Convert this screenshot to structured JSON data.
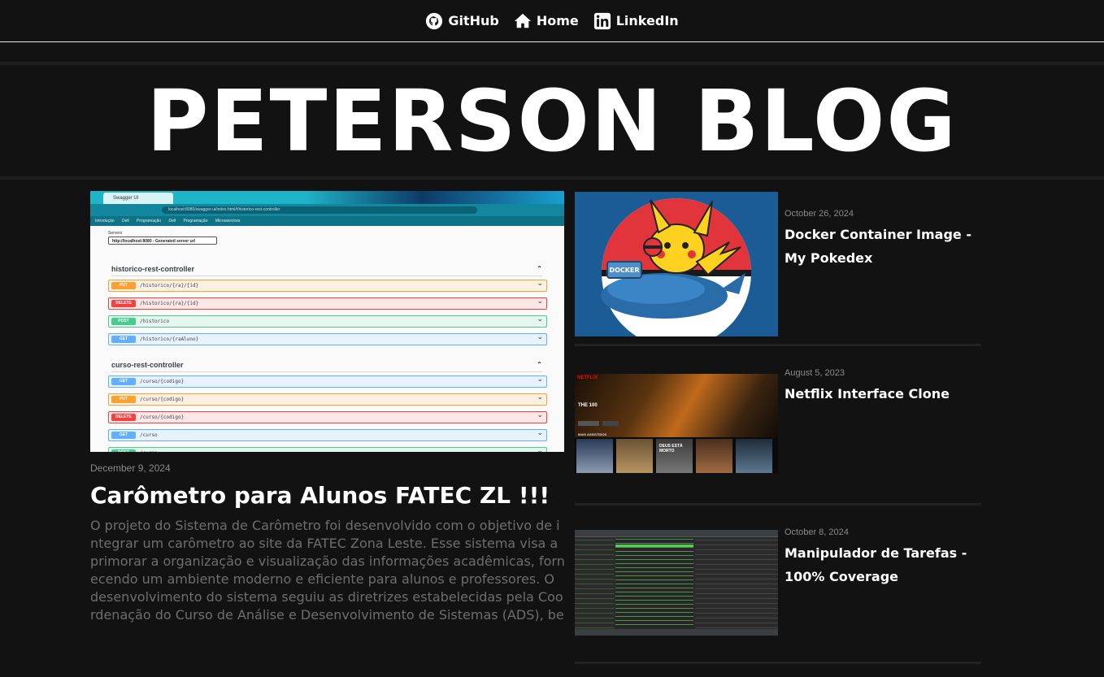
{
  "nav": {
    "items": [
      {
        "label": "GitHub",
        "icon": "github-icon"
      },
      {
        "label": "Home",
        "icon": "home-icon"
      },
      {
        "label": "LinkedIn",
        "icon": "linkedin-icon"
      }
    ]
  },
  "blog": {
    "title": "PETERSON BLOG"
  },
  "featured": {
    "date": "December 9, 2024",
    "title": "Carômetro para Alunos FATEC ZL !!!",
    "excerpt": "O projeto do Sistema de Carômetro foi desenvolvido com o objetivo de integrar um carômetro ao site da FATEC Zona Leste. Esse sistema visa aprimorar a organização e visualização das informações acadêmicas, fornecendo um ambiente moderno e eficiente para alunos e professores. O desenvolvimento do sistema seguiu as diretrizes estabelecidas pela Coordenação do Curso de Análise e Desenvolvimento de Sistemas (ADS), bem como pela professora orientadora da d...",
    "screenshot": {
      "tab_title": "Swagger UI",
      "url": "localhost:8080/swagger-ui/index.html#/historico-rest-controller",
      "bookmarks": [
        "Introdução",
        "Dell",
        "Programação",
        "Dell",
        "Programação",
        "Microservices"
      ],
      "servers_label": "Servers",
      "server_value": "http://localhost:8080 - Generated server url",
      "groups": [
        {
          "name": "historico-rest-controller",
          "endpoints": [
            {
              "method": "PUT",
              "path": "/historico/{ra}/{id}"
            },
            {
              "method": "DELETE",
              "path": "/historico/{ra}/{id}"
            },
            {
              "method": "POST",
              "path": "/historico"
            },
            {
              "method": "GET",
              "path": "/historico/{raAluno}"
            }
          ]
        },
        {
          "name": "curso-rest-controller",
          "endpoints": [
            {
              "method": "GET",
              "path": "/curso/{codigo}"
            },
            {
              "method": "PUT",
              "path": "/curso/{codigo}"
            },
            {
              "method": "DELETE",
              "path": "/curso/{codigo}"
            },
            {
              "method": "GET",
              "path": "/curso"
            },
            {
              "method": "POST",
              "path": "/curso"
            }
          ]
        }
      ]
    }
  },
  "posts": [
    {
      "date": "October 26, 2024",
      "title": "Docker Container Image - My Pokedex",
      "image_text": "DOCKER"
    },
    {
      "date": "August 5, 2023",
      "title": "Netflix Interface Clone",
      "image_brand": "NETFLIX",
      "image_hero": "THE 100",
      "image_row": "MAIS ASSISTIDOS",
      "image_poster": "DEUS ESTÁ MORTO"
    },
    {
      "date": "October 8, 2024",
      "title": "Manipulador de Tarefas - 100% Coverage"
    }
  ],
  "colors": {
    "background": "#121212",
    "put": "#fca130",
    "delete": "#f93e3e",
    "post": "#49cc90",
    "get": "#61affe"
  }
}
